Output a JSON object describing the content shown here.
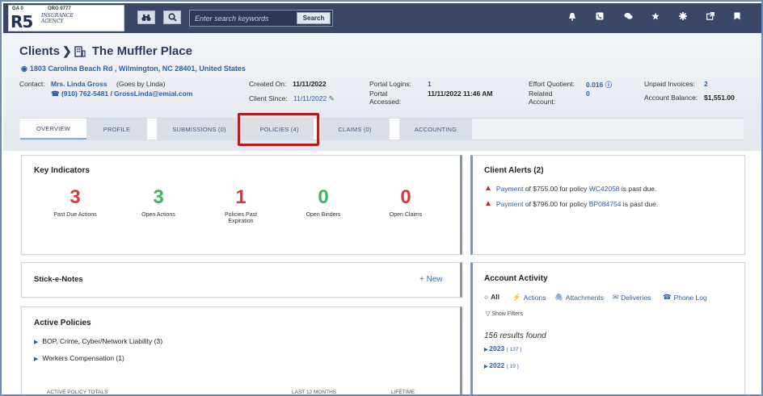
{
  "topbar": {
    "logo": {
      "ga": "GA 0",
      "org": "ORG 0777",
      "brand": "R5",
      "agency": "INSURANCE AGENCY"
    },
    "binoculars_icon": "binoculars-icon",
    "search_icon": "search-icon",
    "search_placeholder": "Enter search keywords",
    "search_button": "Search",
    "icons": [
      "bell-icon",
      "phone-icon",
      "chat-icon",
      "star-icon",
      "external-link-icon",
      "bookmark-icon"
    ]
  },
  "client": {
    "breadcrumb": "Clients",
    "name": "The Muffler Place",
    "address": "1803 Carolina Beach Rd , Wilmington, NC 28401, United States",
    "contact_label": "Contact:",
    "contact_name": "Mrs. Linda Gross",
    "contact_nickname": "(Goes by Linda)",
    "contact_phone": "(910) 762-5481 / GrossLinda@emial.com",
    "created_on_label": "Created On:",
    "created_on": "11/11/2022",
    "client_since_label": "Client Since:",
    "client_since": "11/11/2022",
    "portal_logins_label": "Portal Logins:",
    "portal_logins": "1",
    "portal_accessed_label": "Portal Accessed:",
    "portal_accessed": "11/11/2022 11:46 AM",
    "effort_quotient_label": "Effort Quotient:",
    "effort_quotient": "0.016",
    "related_account_label": "Related Account:",
    "related_account": "0",
    "unpaid_invoices_label": "Unpaid Invoices:",
    "unpaid_invoices": "2",
    "account_balance_label": "Account Balance:",
    "account_balance": "$1,551.00"
  },
  "tabs": [
    {
      "label": "OVERVIEW"
    },
    {
      "label": "PROFILE"
    },
    {
      "label": "SUBMISSIONS (0)"
    },
    {
      "label": "POLICIES (4)"
    },
    {
      "label": "CLAIMS (0)"
    },
    {
      "label": "ACCOUNTING"
    }
  ],
  "key_indicators": {
    "title": "Key Indicators",
    "items": [
      {
        "value": "3",
        "label": "Past Due Actions",
        "color": "#d63a3a"
      },
      {
        "value": "3",
        "label": "Open Actions",
        "color": "#3bb45a"
      },
      {
        "value": "1",
        "label": "Policies Past Expiration",
        "color": "#d63a3a"
      },
      {
        "value": "0",
        "label": "Open Binders",
        "color": "#3bb45a"
      },
      {
        "value": "0",
        "label": "Open Claims",
        "color": "#d63a3a"
      }
    ]
  },
  "client_alerts": {
    "title": "Client Alerts (2)",
    "alerts": [
      {
        "link": "Payment",
        "text": " of $755.00 for policy ",
        "policy": "WC42058",
        "tail": " is past due."
      },
      {
        "link": "Payment",
        "text": " of $796.00 for policy ",
        "policy": "BP084754",
        "tail": " is past due."
      }
    ]
  },
  "stick_notes": {
    "title": "Stick-e-Notes",
    "new_label": "New"
  },
  "account_activity": {
    "title": "Account Activity",
    "filters": [
      "All",
      "Actions",
      "Attachments",
      "Deliveries",
      "Phone Log"
    ],
    "show_filters": "Show Filters",
    "results": "156 results found",
    "years": [
      {
        "year": "2023",
        "count": "( 137 )"
      },
      {
        "year": "2022",
        "count": "( 19 )"
      }
    ]
  },
  "active_policies": {
    "title": "Active Policies",
    "items": [
      {
        "label": "BOP, Crime, Cyber/Network Liability (3)"
      },
      {
        "label": "Workers Compensation (1)"
      }
    ],
    "totals_label": "ACTIVE POLICY TOTALS",
    "last12_label": "LAST 12 MONTHS",
    "lifetime_label": "LIFETIME"
  }
}
